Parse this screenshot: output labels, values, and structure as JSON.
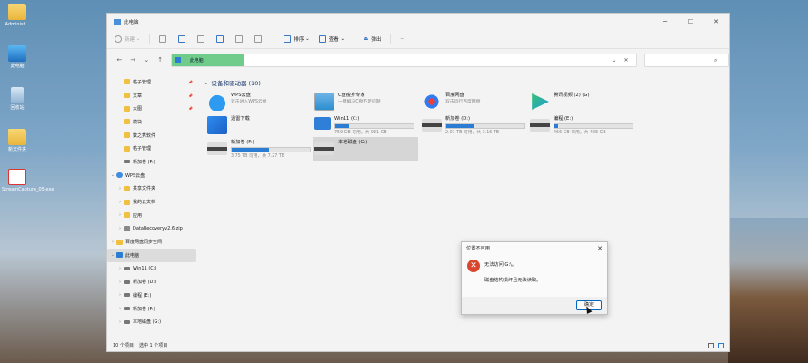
{
  "desktop": {
    "icons": [
      {
        "label": "Administ...",
        "type": "folder"
      },
      {
        "label": "此电脑",
        "type": "pc"
      },
      {
        "label": "回收站",
        "type": "bin"
      },
      {
        "label": "新文件夹",
        "type": "folder"
      },
      {
        "label": "StreamCapture_05.exe",
        "type": "app"
      }
    ]
  },
  "window": {
    "tab_title": "此电脑",
    "controls": {
      "minimize": "─",
      "maximize": "☐",
      "close": "✕"
    }
  },
  "toolbar": {
    "new_label": "新建",
    "sort_label": "排序",
    "view_label": "查看",
    "eject_label": "弹出",
    "more_label": "···"
  },
  "address": {
    "crumb": "此电脑",
    "search_placeholder": ""
  },
  "sidebar": {
    "items": [
      {
        "label": "帖子管理",
        "icon": "folder",
        "pinned": true,
        "chevron": false,
        "indent": 1
      },
      {
        "label": "文章",
        "icon": "folder",
        "pinned": true,
        "chevron": false,
        "indent": 1
      },
      {
        "label": "大图",
        "icon": "folder",
        "pinned": true,
        "chevron": false,
        "indent": 1
      },
      {
        "label": "模块",
        "icon": "folder",
        "pinned": false,
        "chevron": false,
        "indent": 1
      },
      {
        "label": "数之秀软件",
        "icon": "folder",
        "pinned": false,
        "chevron": false,
        "indent": 1
      },
      {
        "label": "帖子管理",
        "icon": "folder",
        "pinned": false,
        "chevron": false,
        "indent": 1
      },
      {
        "label": "新加卷 (F:)",
        "icon": "drive",
        "pinned": false,
        "chevron": false,
        "indent": 1
      },
      {
        "label": "WPS云盘",
        "icon": "cloud",
        "pinned": false,
        "chevron": "v",
        "indent": 0
      },
      {
        "label": "共享文件夹",
        "icon": "folder",
        "pinned": false,
        "chevron": ">",
        "indent": 1
      },
      {
        "label": "我的云文档",
        "icon": "folder",
        "pinned": false,
        "chevron": ">",
        "indent": 1
      },
      {
        "label": "应用",
        "icon": "folder",
        "pinned": false,
        "chevron": ">",
        "indent": 1
      },
      {
        "label": "DataRecoveryv2.6.zip",
        "icon": "zip",
        "pinned": false,
        "chevron": ">",
        "indent": 1
      },
      {
        "label": "百度网盘同步空间",
        "icon": "folder",
        "pinned": false,
        "chevron": ">",
        "indent": 0
      },
      {
        "label": "此电脑",
        "icon": "pc",
        "pinned": false,
        "chevron": "v",
        "indent": 0,
        "selected": true
      },
      {
        "label": "Win11 (C:)",
        "icon": "drive",
        "pinned": false,
        "chevron": ">",
        "indent": 1
      },
      {
        "label": "新加卷 (D:)",
        "icon": "drive",
        "pinned": false,
        "chevron": ">",
        "indent": 1
      },
      {
        "label": "编程 (E:)",
        "icon": "drive",
        "pinned": false,
        "chevron": ">",
        "indent": 1
      },
      {
        "label": "新加卷 (F:)",
        "icon": "drive",
        "pinned": false,
        "chevron": ">",
        "indent": 1
      },
      {
        "label": "本地磁盘 (G:)",
        "icon": "drive",
        "pinned": false,
        "chevron": ">",
        "indent": 1
      }
    ]
  },
  "main": {
    "group_title": "设备和驱动器 (10)",
    "tiles": [
      {
        "name": "WPS云盘",
        "sub": "双击进入WPS云盘",
        "icon": "cloud"
      },
      {
        "name": "C盘瘦身专家",
        "sub": "一键解决C盘不足问题",
        "icon": "broom"
      },
      {
        "name": "百度网盘",
        "sub": "双击运行百度网盘",
        "icon": "baidu"
      },
      {
        "name": "腾讯视频 (2) (G)",
        "sub": "",
        "icon": "play"
      },
      {
        "name": "迅雷下载",
        "sub": "",
        "icon": "bird"
      },
      {
        "name": "Win11 (C:)",
        "sub": "759 GB 可用，共 931 GB",
        "icon": "win",
        "used": 0.18
      },
      {
        "name": "新加卷 (D:)",
        "sub": "2.01 TB 可用，共 3.16 TB",
        "icon": "drive",
        "used": 0.36
      },
      {
        "name": "编程 (E:)",
        "sub": "466 GB 可用，共 488 GB",
        "icon": "drive",
        "used": 0.05
      },
      {
        "name": "新加卷 (F:)",
        "sub": "3.75 TB 可用，共 7.27 TB",
        "icon": "drive",
        "used": 0.48
      },
      {
        "name": "本地磁盘 (G:)",
        "sub": "",
        "icon": "drive",
        "selected": true
      }
    ]
  },
  "status": {
    "count": "10 个项目",
    "selected": "选中 1 个项目"
  },
  "dialog": {
    "title": "位置不可用",
    "message": "无法访问 G:\\。",
    "detail": "磁盘结构损坏且无法读取。",
    "ok_label": "确定"
  }
}
